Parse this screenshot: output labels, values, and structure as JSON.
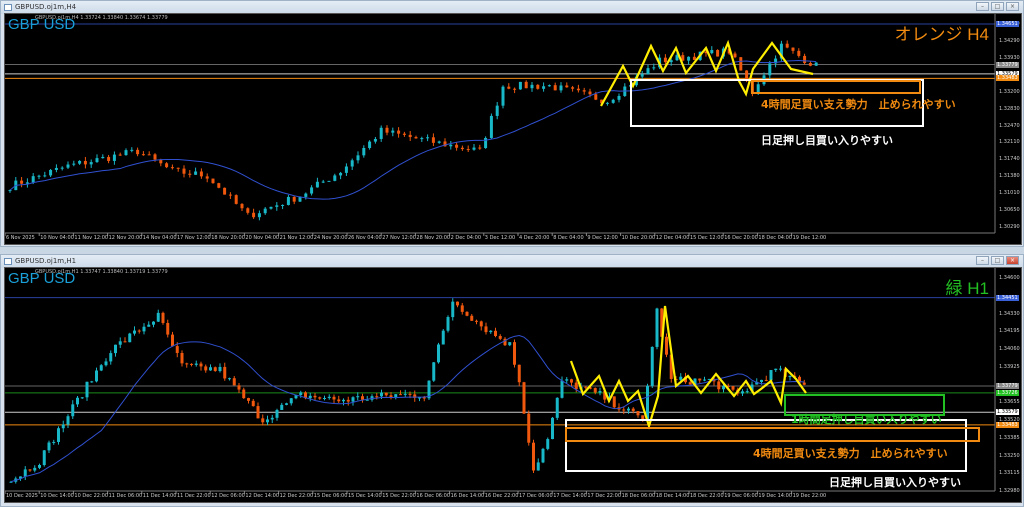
{
  "windows": [
    {
      "title": "GBPUSD.oj1m,H4",
      "ohlc": "GBPUSD.oj1m,H4  1.33724 1.33840 1.33674 1.33779",
      "symbol_label": "GBP USD",
      "timeframe_label": "オレンジ H4",
      "timeframe_color": "#f08a10",
      "notes": {
        "orange": "4時間足買い支え勢力　止められやすい",
        "white": "日足押し目買い入りやすい"
      }
    },
    {
      "title": "GBPUSD.oj1m,H1",
      "ohlc": "GBPUSD.oj1m,H1  1.33747 1.33840 1.33719 1.33779",
      "symbol_label": "GBP USD",
      "timeframe_label": "緑 H1",
      "timeframe_color": "#22c022",
      "notes": {
        "green": "1時間足押し目買い入りやすい",
        "orange": "4時間足買い支え勢力　止められやすい",
        "white": "日足押し目買い入りやすい"
      }
    }
  ],
  "colors": {
    "bull": "#19b8c8",
    "bear": "#f0580e",
    "ma": "#3050d0",
    "zigzag": "#ffee00"
  },
  "chart_data": [
    {
      "type": "candlestick",
      "name": "GBPUSD H4",
      "ylim": [
        1.3029,
        1.3465
      ],
      "candles": 140,
      "price_ticks": [
        "1.34650",
        "1.34290",
        "1.33930",
        "1.33200",
        "1.32830",
        "1.32470",
        "1.32110",
        "1.31740",
        "1.31380",
        "1.31010",
        "1.30650",
        "1.30290"
      ],
      "price_tags": [
        {
          "value": "1.34651",
          "color": "#3a60d8",
          "line": "#2a40a0"
        },
        {
          "value": "1.33779",
          "color": "#888888",
          "line": "#666666"
        },
        {
          "value": "1.33579",
          "color": "#ffffff",
          "line": "#cccccc"
        },
        {
          "value": "1.33483",
          "color": "#f08a10",
          "line": "#f08a10"
        }
      ],
      "time_labels": [
        "6 Nov 2025",
        "10 Nov 04:00",
        "11 Nov 12:00",
        "12 Nov 20:00",
        "14 Nov 04:00",
        "17 Nov 12:00",
        "18 Nov 20:00",
        "20 Nov 04:00",
        "21 Nov 12:00",
        "24 Nov 20:00",
        "26 Nov 04:00",
        "27 Nov 12:00",
        "28 Nov 20:00",
        "2 Dec 04:00",
        "3 Dec 12:00",
        "4 Dec 20:00",
        "8 Dec 04:00",
        "9 Dec 12:00",
        "10 Dec 20:00",
        "12 Dec 04:00",
        "15 Dec 12:00",
        "16 Dec 20:00",
        "18 Dec 04:00",
        "19 Dec 12:00"
      ],
      "close_keypoints": [
        [
          0,
          1.3117
        ],
        [
          10,
          1.316
        ],
        [
          22,
          1.3192
        ],
        [
          28,
          1.3149
        ],
        [
          34,
          1.3139
        ],
        [
          41,
          1.3053
        ],
        [
          50,
          1.3096
        ],
        [
          57,
          1.3149
        ],
        [
          64,
          1.3235
        ],
        [
          72,
          1.3214
        ],
        [
          81,
          1.3192
        ],
        [
          85,
          1.3332
        ],
        [
          93,
          1.3332
        ],
        [
          103,
          1.33
        ],
        [
          112,
          1.3386
        ],
        [
          124,
          1.3407
        ],
        [
          128,
          1.3321
        ],
        [
          133,
          1.3418
        ],
        [
          139,
          1.3375
        ]
      ]
    },
    {
      "type": "candlestick",
      "name": "GBPUSD H1",
      "ylim": [
        1.3298,
        1.346
      ],
      "candles": 168,
      "price_ticks": [
        "1.34600",
        "1.34330",
        "1.34195",
        "1.34060",
        "1.33925",
        "1.33655",
        "1.33520",
        "1.33385",
        "1.33250",
        "1.33115",
        "1.32980"
      ],
      "price_tags": [
        {
          "value": "1.34451",
          "color": "#3a60d8",
          "line": "#2a40a0"
        },
        {
          "value": "1.33779",
          "color": "#888888",
          "line": "#666666"
        },
        {
          "value": "1.33726",
          "color": "#22c022",
          "line": "#1a8a1a"
        },
        {
          "value": "1.33579",
          "color": "#ffffff",
          "line": "#cccccc"
        },
        {
          "value": "1.33483",
          "color": "#f08a10",
          "line": "#f08a10"
        }
      ],
      "time_labels": [
        "10 Dec 2025",
        "10 Dec 14:00",
        "10 Dec 22:00",
        "11 Dec 06:00",
        "11 Dec 14:00",
        "11 Dec 22:00",
        "12 Dec 06:00",
        "12 Dec 14:00",
        "12 Dec 22:00",
        "15 Dec 06:00",
        "15 Dec 14:00",
        "15 Dec 22:00",
        "16 Dec 06:00",
        "16 Dec 14:00",
        "16 Dec 22:00",
        "17 Dec 06:00",
        "17 Dec 14:00",
        "17 Dec 22:00",
        "18 Dec 06:00",
        "18 Dec 14:00",
        "18 Dec 22:00",
        "19 Dec 06:00",
        "19 Dec 14:00",
        "19 Dec 22:00"
      ],
      "close_keypoints": [
        [
          0,
          1.3306
        ],
        [
          6,
          1.3321
        ],
        [
          14,
          1.3367
        ],
        [
          21,
          1.3405
        ],
        [
          31,
          1.3431
        ],
        [
          36,
          1.3393
        ],
        [
          44,
          1.339
        ],
        [
          53,
          1.3352
        ],
        [
          61,
          1.3371
        ],
        [
          69,
          1.3367
        ],
        [
          81,
          1.3371
        ],
        [
          87,
          1.3371
        ],
        [
          93,
          1.3443
        ],
        [
          99,
          1.3424
        ],
        [
          105,
          1.3409
        ],
        [
          107,
          1.3382
        ],
        [
          110,
          1.3314
        ],
        [
          113,
          1.3337
        ],
        [
          116,
          1.3382
        ],
        [
          124,
          1.3371
        ],
        [
          133,
          1.3352
        ],
        [
          136,
          1.3435
        ],
        [
          139,
          1.3382
        ],
        [
          147,
          1.3382
        ],
        [
          153,
          1.3371
        ],
        [
          161,
          1.339
        ],
        [
          167,
          1.3378
        ]
      ]
    }
  ]
}
